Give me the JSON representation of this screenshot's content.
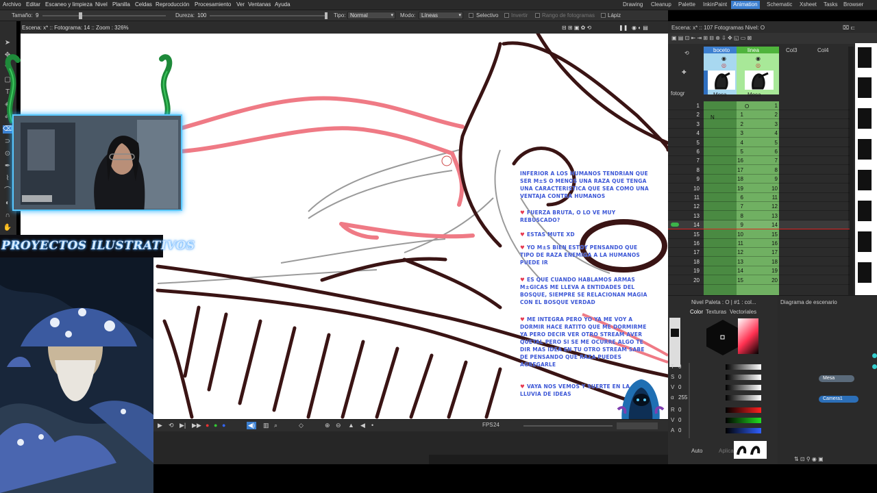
{
  "menu": {
    "items": [
      "Archivo",
      "Editar",
      "Escaneo y limpieza",
      "Nivel",
      "Planilla",
      "Celdas",
      "Reproducción",
      "Procesamiento",
      "Ver",
      "Ventanas",
      "Ayuda"
    ],
    "rooms": [
      "Drawing",
      "Cleanup",
      "Palette",
      "InkinPaint",
      "Animation",
      "Schematic",
      "Xsheet",
      "Tasks",
      "Browser"
    ],
    "active_room": "Animation"
  },
  "tool_options": {
    "size_label": "Tamaño:",
    "size_value": "9",
    "hardness_label": "Dureza:",
    "hardness_value": "100",
    "type_label": "Tipo:",
    "type_value": "Normal",
    "mode_label": "Modo:",
    "mode_value": "Líneas",
    "selective": "Selectivo",
    "invert": "Invertir",
    "frame_range": "Rango de fotogramas",
    "pencil": "Lápiz"
  },
  "viewer": {
    "header": "Escena: x*  ::  Fotograma: 14  ::  Zoom : 326%"
  },
  "stream": {
    "banner": "PROYECTOS ILUSTRATIVOS",
    "chat": [
      {
        "text": "INFERIOR A LOS HUMANOS TENDRIAN QUE SER M±S O MENOS UNA RAZA QUE TENGA UNA CARACTERISTICA QUE SEA COMO UNA VENTAJA CONTRA HUMANOS",
        "heart": false
      },
      {
        "text": "FUERZA BRUTA, O LO VE MUY REBUSCADO?",
        "heart": true
      },
      {
        "text": "ESTAS MUTE XD",
        "heart": true
      },
      {
        "text": "YO M±S BIEN ESTOY PENSANDO QUE TIPO DE RAZA ENEMIGA A LA HUMANOS PUEDE IR",
        "heart": true
      },
      {
        "text": "ES QUE CUANDO HABLAMOS ARMAS M±GICAS ME LLEVA A ENTIDADES DEL BOSQUE, SIEMPRE SE RELACIONAN MAGIA CON EL BOSQUE VERDAD",
        "heart": true
      },
      {
        "text": "ME INTEGRA PERO YO YA ME VOY A DORMIR HACE RATITO QUE ME DORMIRME YA PERO DECIR VER OTRO STREAM AVER QUETAL PERO SI SE ME OCURRE ALGO TE DIR MAS IDEA EN TU OTRO STREAM SABE DE PENSANDO QUE RAZA PUEDES AGREGARLE",
        "heart": true
      },
      {
        "text": "VAYA NOS VEMOS Y SUERTE EN LA LLUVIA DE IDEAS",
        "heart": true
      }
    ]
  },
  "playback": {
    "fps_label": "FPS",
    "fps_value": "24"
  },
  "xsheet": {
    "header": "Escena: x*  ::  107 Fotogramas Nivel: O",
    "columns": [
      "boceto",
      "linea",
      "Col3",
      "Col4"
    ],
    "pegbar": "Mesa",
    "frame_label": "fotogr",
    "current_frame": 14,
    "col1_top": "N",
    "col2_top": "O",
    "frames": [
      {
        "f": "1",
        "a": "",
        "b": "1"
      },
      {
        "f": "2",
        "a": "1",
        "b": "2"
      },
      {
        "f": "3",
        "a": "2",
        "b": "3"
      },
      {
        "f": "4",
        "a": "3",
        "b": "4"
      },
      {
        "f": "5",
        "a": "4",
        "b": "5"
      },
      {
        "f": "6",
        "a": "5",
        "b": "6"
      },
      {
        "f": "7",
        "a": "16",
        "b": "7"
      },
      {
        "f": "8",
        "a": "17",
        "b": "8"
      },
      {
        "f": "9",
        "a": "18",
        "b": "9"
      },
      {
        "f": "10",
        "a": "19",
        "b": "10"
      },
      {
        "f": "11",
        "a": "6",
        "b": "11"
      },
      {
        "f": "12",
        "a": "7",
        "b": "12"
      },
      {
        "f": "13",
        "a": "8",
        "b": "13"
      },
      {
        "f": "14",
        "a": "9",
        "b": "14"
      },
      {
        "f": "15",
        "a": "10",
        "b": "15"
      },
      {
        "f": "16",
        "a": "11",
        "b": "16"
      },
      {
        "f": "17",
        "a": "12",
        "b": "17"
      },
      {
        "f": "18",
        "a": "13",
        "b": "18"
      },
      {
        "f": "19",
        "a": "14",
        "b": "19"
      },
      {
        "f": "20",
        "a": "15",
        "b": "20"
      }
    ]
  },
  "palette": {
    "title": "Nivel Paleta : O | #1 : col...",
    "tabs": [
      "Color",
      "Texturas",
      "Vectoriales"
    ],
    "channels": [
      {
        "k": "T",
        "v": "0",
        "color": "#ffffff"
      },
      {
        "k": "S",
        "v": "0",
        "color": "#ffffff"
      },
      {
        "k": "V",
        "v": "0",
        "color": "#ffffff"
      },
      {
        "k": "α",
        "v": "255",
        "color": "#ffffff"
      },
      {
        "k": "R",
        "v": "0",
        "color": "#ff2020"
      },
      {
        "k": "V",
        "v": "0",
        "color": "#20e020"
      },
      {
        "k": "A",
        "v": "0",
        "color": "#3060ff"
      }
    ],
    "auto": "Auto",
    "apply": "Aplicar"
  },
  "schematic": {
    "title": "Diagrama de escenario",
    "nodes": [
      "Mesa",
      "Camera1"
    ]
  }
}
